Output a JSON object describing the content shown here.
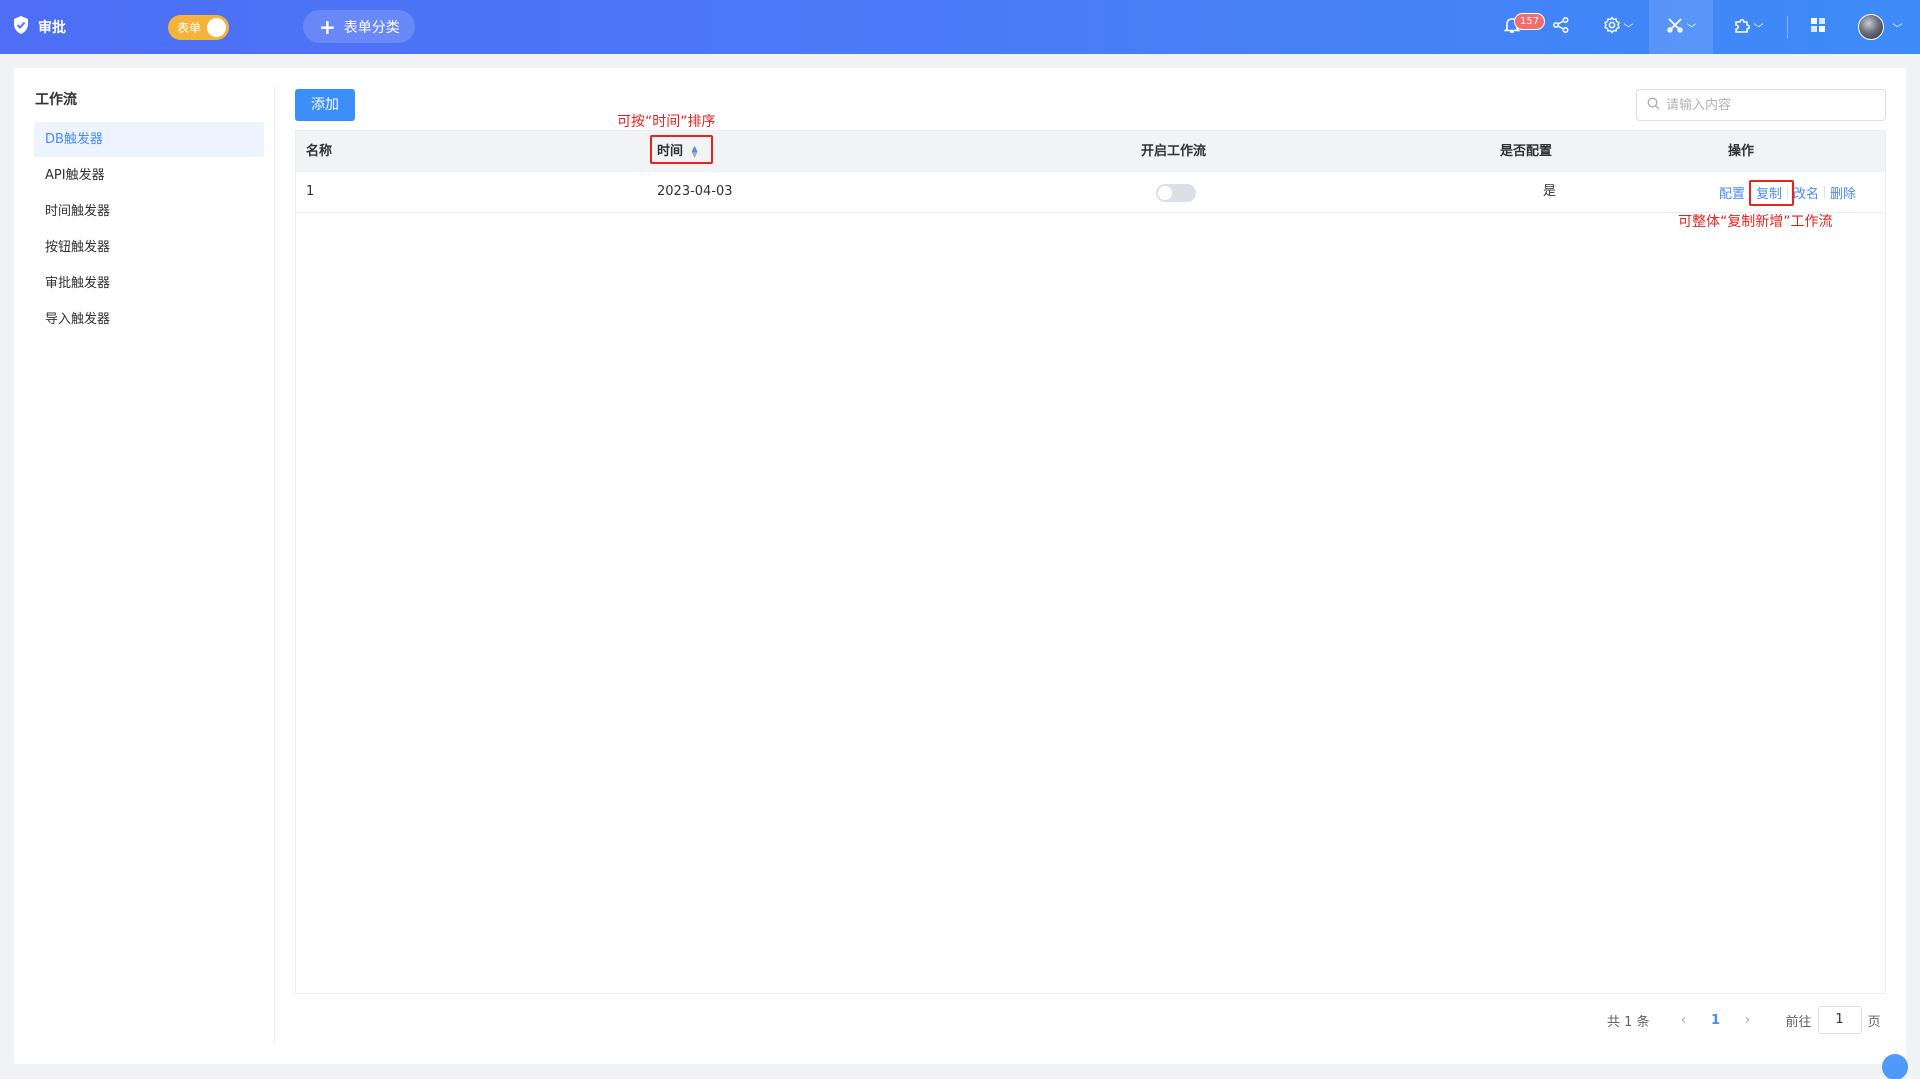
{
  "app": {
    "title": "审批",
    "form_toggle_label": "表单",
    "category_button": "表单分类",
    "notification_count": "157"
  },
  "icons": {
    "logo": "shield-check-icon",
    "bell": "bell-icon",
    "share": "share-icon",
    "settings": "gear-icon",
    "tools": "tools-icon",
    "plugin": "puzzle-icon",
    "apps": "apps-grid-icon",
    "search": "search-icon"
  },
  "colors": {
    "primary": "#3c8ef8",
    "topbar": "#4a7cf7",
    "annotation": "#e6231d",
    "toggle": "#f5b33a"
  },
  "sidebar": {
    "title": "工作流",
    "items": [
      {
        "label": "DB触发器",
        "active": true
      },
      {
        "label": "API触发器"
      },
      {
        "label": "时间触发器"
      },
      {
        "label": "按钮触发器"
      },
      {
        "label": "审批触发器"
      },
      {
        "label": "导入触发器"
      }
    ]
  },
  "toolbar": {
    "add_label": "添加",
    "search_placeholder": "请输入内容"
  },
  "table": {
    "columns": [
      "名称",
      "时间",
      "开启工作流",
      "是否配置",
      "操作"
    ],
    "rows": [
      {
        "name": "1",
        "time": "2023-04-03",
        "enabled": false,
        "configured": "是",
        "actions": [
          "配置",
          "复制",
          "改名",
          "删除"
        ]
      }
    ]
  },
  "annotations": {
    "sort_note": "可按“时间”排序",
    "copy_note": "可整体“复制新增”工作流"
  },
  "pagination": {
    "total": "共 1 条",
    "current": "1",
    "goto_label": "前往",
    "goto_value": "1",
    "page_suffix": "页"
  }
}
